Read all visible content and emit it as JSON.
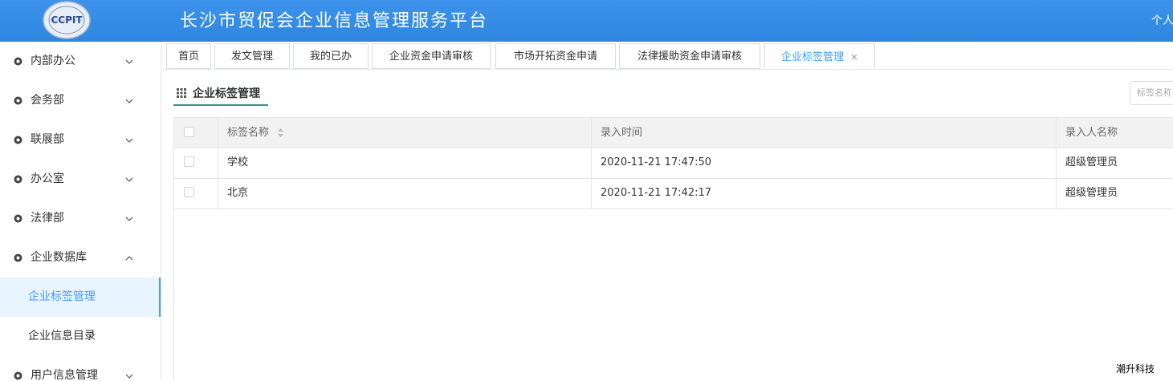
{
  "header": {
    "logo_text": "CCPIT",
    "title": "长沙市贸促会企业信息管理服务平台",
    "user_link": "个人"
  },
  "sidebar": {
    "items": [
      {
        "label": "内部办公",
        "expanded": false
      },
      {
        "label": "会务部",
        "expanded": false
      },
      {
        "label": "联展部",
        "expanded": false
      },
      {
        "label": "办公室",
        "expanded": false
      },
      {
        "label": "法律部",
        "expanded": false
      },
      {
        "label": "企业数据库",
        "expanded": true,
        "children": [
          {
            "label": "企业标签管理",
            "active": true
          },
          {
            "label": "企业信息目录",
            "active": false
          }
        ]
      },
      {
        "label": "用户信息管理",
        "expanded": false
      }
    ]
  },
  "tabs": [
    {
      "label": "首页"
    },
    {
      "label": "发文管理"
    },
    {
      "label": "我的已办"
    },
    {
      "label": "企业资金申请审核"
    },
    {
      "label": "市场开拓资金申请"
    },
    {
      "label": "法律援助资金申请审核"
    },
    {
      "label": "企业标签管理",
      "active": true,
      "close": "×"
    }
  ],
  "panel": {
    "title": "企业标签管理",
    "search_placeholder": "标签名称"
  },
  "table": {
    "headers": [
      "标签名称",
      "录入时间",
      "录入人名称"
    ],
    "rows": [
      [
        "学校",
        "2020-11-21 17:47:50",
        "超级管理员"
      ],
      [
        "北京",
        "2020-11-21 17:42:17",
        "超级管理员"
      ]
    ]
  },
  "footer": {
    "text": "潮升科技"
  },
  "colors": {
    "header_bg": "#3a8ee6",
    "accent": "#409eff",
    "panel_underline": "#3e8f84"
  }
}
